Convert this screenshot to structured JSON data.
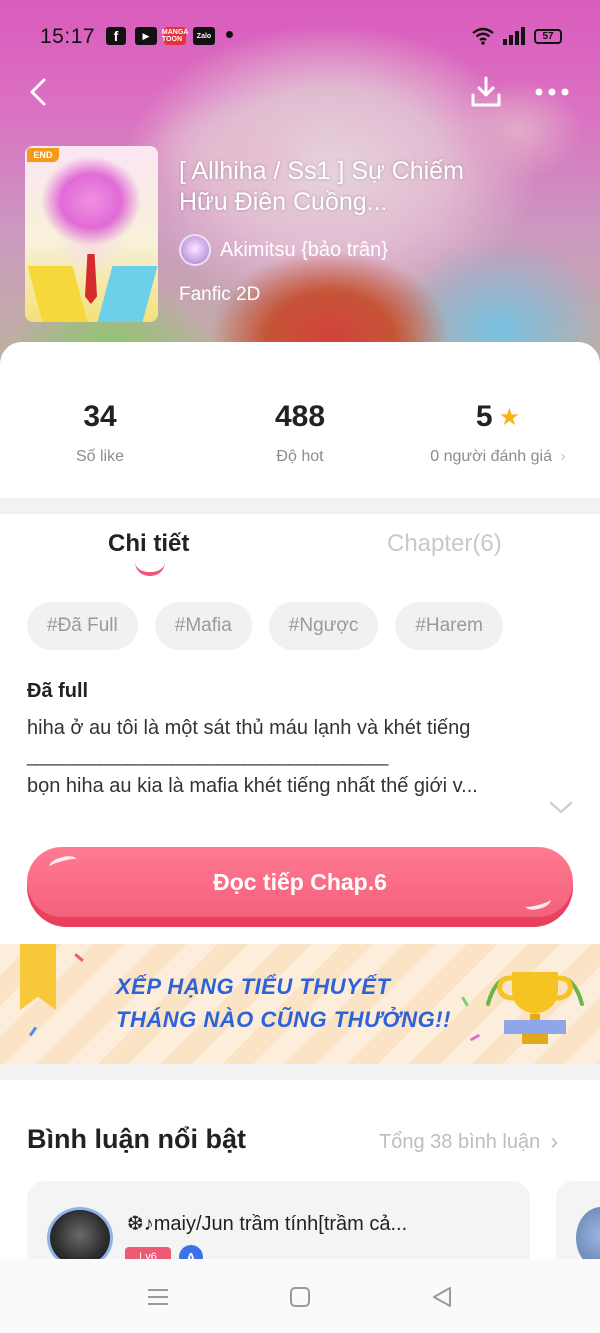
{
  "status_bar": {
    "time": "15:17",
    "app_icons": [
      "facebook-icon",
      "youtube-icon",
      "mangatoon-icon",
      "zalo-icon"
    ],
    "mangatoon_label": "MANGA TOON",
    "zalo_label": "Zalo",
    "battery": "57"
  },
  "story": {
    "badge": "END",
    "title": "[ Allhiha / Ss1 ] Sự Chiếm Hữu Điên Cuồng...",
    "title_line1": "[ Allhiha / Ss1 ] Sự Chiếm",
    "title_line2": "Hữu Điên Cuồng...",
    "author": "Akimitsu {bảo trân}",
    "genre": "Fanfic 2D"
  },
  "stats": {
    "likes": {
      "value": "34",
      "label": "Số like"
    },
    "hot": {
      "value": "488",
      "label": "Độ hot"
    },
    "rating": {
      "value": "5",
      "label": "0 người đánh giá"
    }
  },
  "tabs": {
    "detail": "Chi tiết",
    "chapter": "Chapter(6)"
  },
  "tags": [
    "#Đã Full",
    "#Mafia",
    "#Ngược",
    "#Harem"
  ],
  "description": {
    "heading": "Đã full",
    "line1": "hiha ở au tôi là một sát thủ máu lạnh và khét tiếng",
    "separator": "________________________________________",
    "line2": "bọn hiha au kia là mafia khét tiếng nhất thế giới v..."
  },
  "read_button": "Đọc tiếp Chap.6",
  "banner": {
    "line1": "XẾP HẠNG TIỂU THUYẾT",
    "line2": "THÁNG NÀO CŨNG THƯỞNG!!"
  },
  "comments": {
    "title": "Bình luận nổi bật",
    "total": "Tổng 38 bình luận",
    "items": [
      {
        "name": "❆♪maiy/Jun trầm tính[trầm cả...",
        "level": "Lv6",
        "badge": "A"
      }
    ]
  },
  "colors": {
    "accent": "#f4607a",
    "star": "#f6b51c",
    "banner_text": "#2e62d9"
  }
}
